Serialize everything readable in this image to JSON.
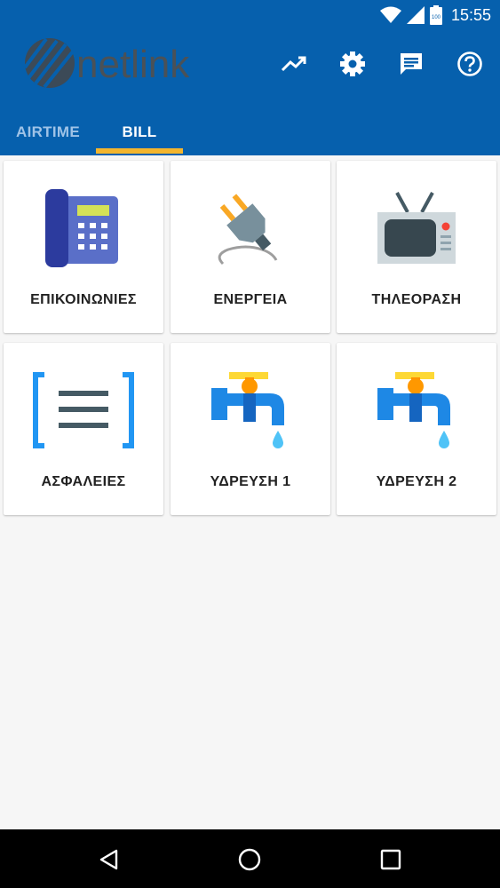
{
  "status_bar": {
    "time": "15:55",
    "battery_label": "100",
    "icons": [
      "wifi-icon",
      "cellular-signal-icon",
      "battery-icon"
    ]
  },
  "app_bar": {
    "logo_text": "netlink",
    "actions": [
      "trend-chart-icon",
      "settings-gear-icon",
      "message-icon",
      "help-icon"
    ]
  },
  "tabs": [
    {
      "label": "AIRTIME",
      "selected": false
    },
    {
      "label": "BILL",
      "selected": true
    }
  ],
  "categories": [
    {
      "label": "ΕΠΙΚΟΙΝΩΝΙΕΣ",
      "icon": "telephone-icon"
    },
    {
      "label": "ΕΝΕΡΓΕΙΑ",
      "icon": "power-plug-icon"
    },
    {
      "label": "ΤΗΛΕΟΡΑΣΗ",
      "icon": "television-icon"
    },
    {
      "label": "ΑΣΦΑΛΕΙΕΣ",
      "icon": "insurance-document-icon"
    },
    {
      "label": "ΥΔΡΕΥΣΗ 1",
      "icon": "water-tap-icon"
    },
    {
      "label": "ΥΔΡΕΥΣΗ 2",
      "icon": "water-tap-icon"
    }
  ],
  "nav_bar": [
    "back-icon",
    "home-icon",
    "recents-icon"
  ],
  "colors": {
    "primary": "#0660ad",
    "tab_indicator": "#f3b52e",
    "tab_inactive": "#9fc3e7",
    "background": "#f6f6f6"
  }
}
